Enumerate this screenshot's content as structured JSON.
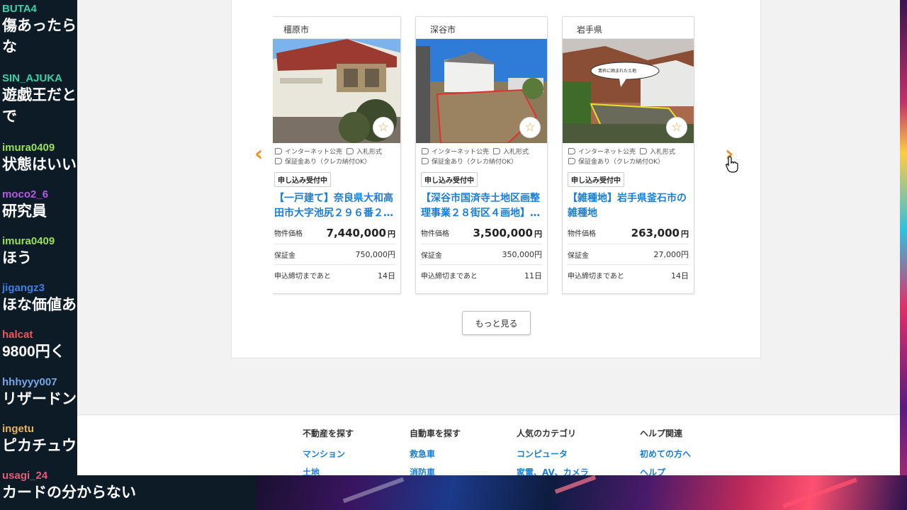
{
  "chat": {
    "messages": [
      {
        "user": "BUTA4",
        "color": "#3ad1a8",
        "lines": [
          "傷あったら",
          "な"
        ]
      },
      {
        "user": "SIN_AJUKA",
        "color": "#3ad1a8",
        "lines": [
          "遊戯王だと",
          "で"
        ]
      },
      {
        "user": "imura0409",
        "color": "#9adf5a",
        "lines": [
          "状態はいい"
        ]
      },
      {
        "user": "moco2_6",
        "color": "#b45ae6",
        "lines": [
          "研究員"
        ]
      },
      {
        "user": "imura0409",
        "color": "#9adf5a",
        "lines": [
          "ほう"
        ]
      },
      {
        "user": "jigangz3",
        "color": "#3a7ee6",
        "lines": [
          "ほな価値あ"
        ]
      },
      {
        "user": "halcat",
        "color": "#e65a5a",
        "lines": [
          "9800円く"
        ]
      },
      {
        "user": "hhhyyy007",
        "color": "#7aa6e6",
        "lines": [
          "リザードン"
        ]
      },
      {
        "user": "ingetu",
        "color": "#e6b45a",
        "lines": [
          "ピカチュウ"
        ]
      },
      {
        "user": "usagi_24",
        "color": "#e65a7a",
        "lines": [
          "カードの分からない"
        ]
      }
    ]
  },
  "listings": {
    "cards": [
      {
        "location": "橿原市",
        "tags": [
          "インターネット公売",
          "入札形式",
          "保証金あり（クレカ納付OK）"
        ],
        "status": "申し込み受付中",
        "title": "【一戸建て】奈良県大和高田市大字池尻２９６番２…",
        "price_label": "物件価格",
        "price": "7,440,000",
        "price_unit": "円",
        "deposit_label": "保証金",
        "deposit": "750,000円",
        "deadline_label": "申込締切まであと",
        "deadline": "14日"
      },
      {
        "location": "深谷市",
        "tags": [
          "インターネット公売",
          "入札形式",
          "保証金あり（クレカ納付OK）"
        ],
        "status": "申し込み受付中",
        "title": "【深谷市国済寺土地区画整理事業２８街区４画地】…",
        "price_label": "物件価格",
        "price": "3,500,000",
        "price_unit": "円",
        "deposit_label": "保証金",
        "deposit": "350,000円",
        "deadline_label": "申込締切まであと",
        "deadline": "11日"
      },
      {
        "location": "岩手県",
        "tags": [
          "インターネット公売",
          "入札形式",
          "保証金あり（クレカ納付OK）"
        ],
        "status": "申し込み受付中",
        "title": "【雑種地】岩手県釜石市の雑種地",
        "price_label": "物件価格",
        "price": "263,000",
        "price_unit": "円",
        "deposit_label": "保証金",
        "deposit": "27,000円",
        "deadline_label": "申込締切まであと",
        "deadline": "14日",
        "image_callout": "青枠に囲まれた土地"
      }
    ],
    "more_label": "もっと見る",
    "prev_icon": "chevron-left-icon",
    "next_icon": "chevron-right-icon",
    "favorite_icon": "star-icon"
  },
  "footer": {
    "columns": [
      {
        "heading": "不動産を探す",
        "links": [
          "マンション",
          "土地"
        ]
      },
      {
        "heading": "自動車を探す",
        "links": [
          "救急車",
          "消防車"
        ]
      },
      {
        "heading": "人気のカテゴリ",
        "links": [
          "コンピュータ",
          "家電、AV、カメラ"
        ]
      },
      {
        "heading": "ヘルプ関連",
        "links": [
          "初めての方へ",
          "ヘルプ"
        ]
      }
    ]
  },
  "colors": {
    "accent_orange": "#e8962a",
    "link_blue": "#1a7dd6"
  }
}
